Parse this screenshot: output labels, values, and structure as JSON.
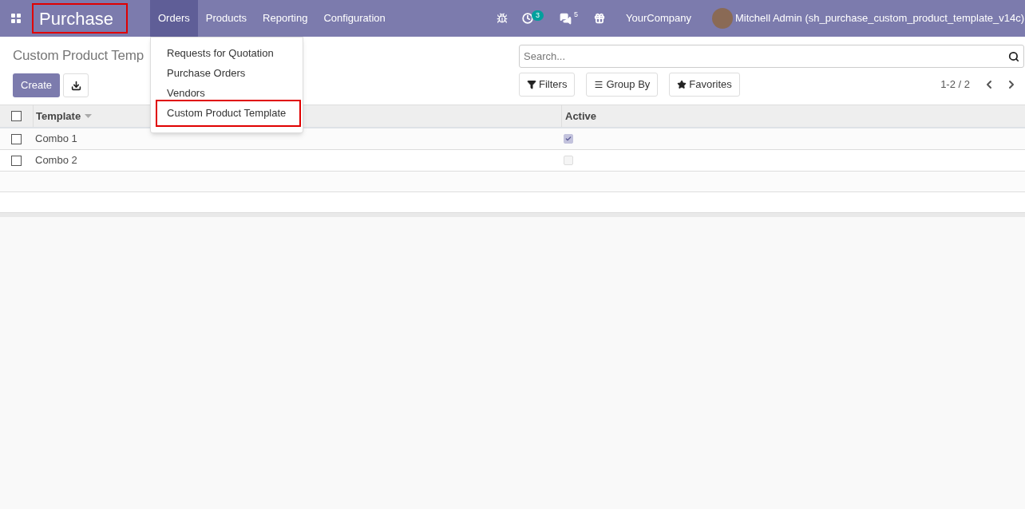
{
  "navbar": {
    "app_name": "Purchase",
    "app_name_highlighted": true,
    "menu": [
      {
        "label": "Orders",
        "selected": true
      },
      {
        "label": "Products",
        "selected": false
      },
      {
        "label": "Reporting",
        "selected": false
      },
      {
        "label": "Configuration",
        "selected": false
      }
    ],
    "activity_count": "3",
    "message_count": "5",
    "company": "YourCompany",
    "user": "Mitchell Admin (sh_purchase_custom_product_template_v14c)"
  },
  "dropdown": [
    {
      "label": "Requests for Quotation",
      "highlighted": false
    },
    {
      "label": "Purchase Orders",
      "highlighted": false
    },
    {
      "label": "Vendors",
      "highlighted": false
    },
    {
      "label": "Custom Product Template",
      "highlighted": true
    }
  ],
  "breadcrumb": "Custom Product Temp",
  "create_button": "Create",
  "search": {
    "placeholder": "Search..."
  },
  "filters": [
    "Filters",
    "Group By",
    "Favorites"
  ],
  "pager": "1-2 / 2",
  "table": {
    "all_selected": false,
    "columns": [
      "Template",
      "Active"
    ],
    "rows": [
      {
        "template": "Combo 1",
        "active": true,
        "selected": false
      },
      {
        "template": "Combo 2",
        "active": false,
        "selected": false
      }
    ]
  }
}
